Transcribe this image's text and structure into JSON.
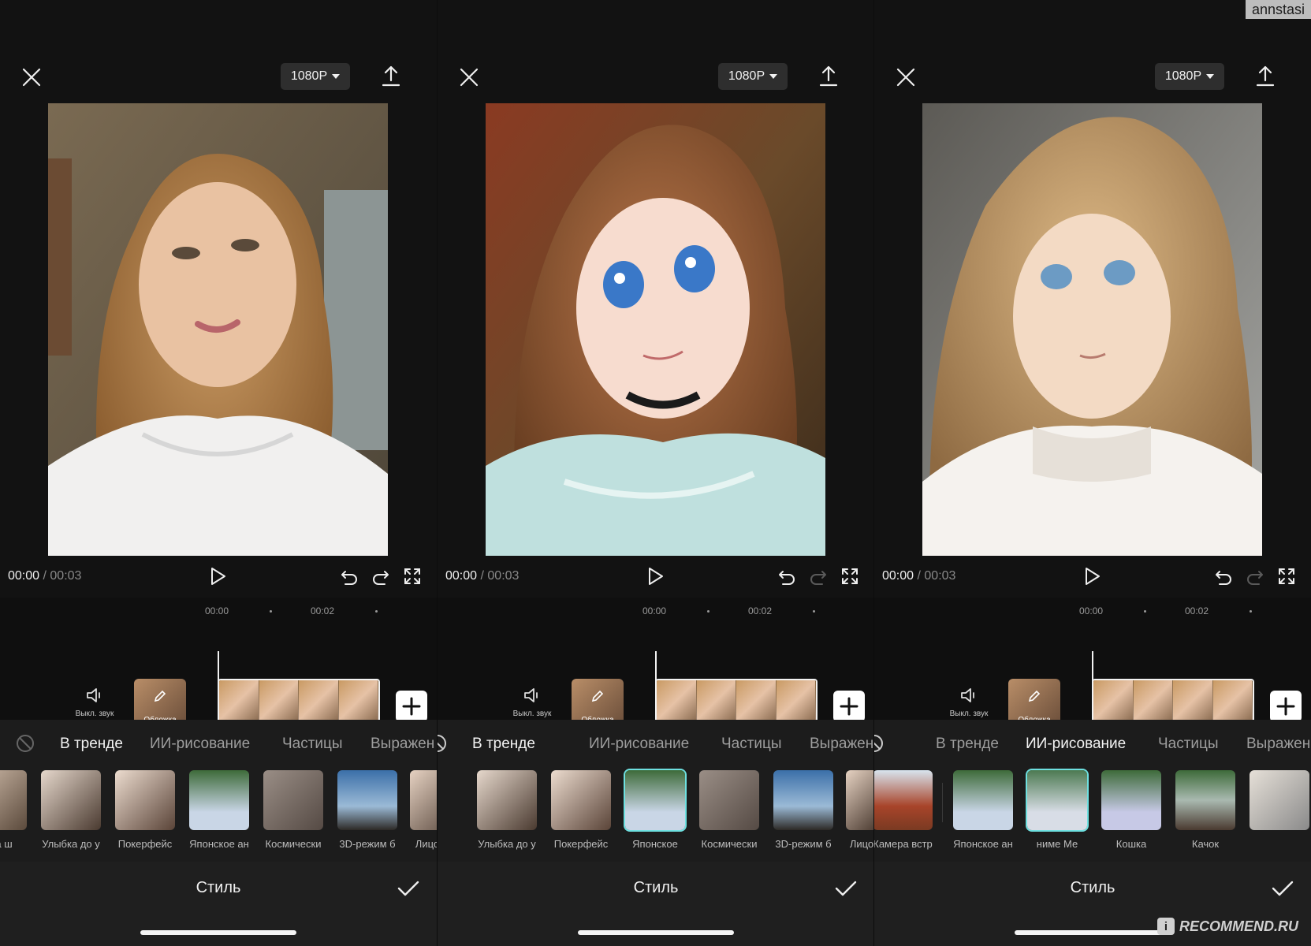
{
  "watermarks": {
    "user": "annstasi",
    "site": "RECOMMEND.RU",
    "site_badge": "i"
  },
  "colors": {
    "background": "#121212",
    "accent_selection": "#6ee0e0"
  },
  "panels": [
    {
      "resolution": "1080P",
      "time_current": "00:00",
      "time_sep": "/",
      "time_total": "00:03",
      "ruler": [
        "00:00",
        "00:02"
      ],
      "mute_label": "Выкл. звук",
      "cover_label": "Обложка",
      "redo_enabled": true,
      "tabs": [
        "В тренде",
        "ИИ-рисование",
        "Частицы",
        "Выражен"
      ],
      "active_tab": 0,
      "effects": [
        "а на ш",
        "Улыбка до у",
        "Покерфейс",
        "Японское ан",
        "Космически",
        "3D-режим б",
        "Лицо на ш"
      ],
      "style_title": "Стиль"
    },
    {
      "resolution": "1080P",
      "time_current": "00:00",
      "time_sep": "/",
      "time_total": "00:03",
      "ruler": [
        "00:00",
        "00:02"
      ],
      "mute_label": "Выкл. звук",
      "cover_label": "Обложка",
      "redo_enabled": false,
      "tabs": [
        "В тренде",
        "ИИ-рисование",
        "Частицы",
        "Выражен"
      ],
      "active_tab": 0,
      "effects": [
        "Улыбка до у",
        "Покерфейс",
        "Японское",
        "Космически",
        "3D-режим б",
        "Лицо"
      ],
      "selected_effect": 2,
      "style_title": "Стиль"
    },
    {
      "resolution": "1080P",
      "time_current": "00:00",
      "time_sep": "/",
      "time_total": "00:03",
      "ruler": [
        "00:00",
        "00:02"
      ],
      "mute_label": "Выкл. звук",
      "cover_label": "Обложка",
      "redo_enabled": false,
      "tabs": [
        "В тренде",
        "ИИ-рисование",
        "Частицы",
        "Выражен"
      ],
      "active_tab": 1,
      "effects": [
        "Камера встр",
        "Японское ан",
        "ниме Ме",
        "Кошка",
        "Качок"
      ],
      "selected_effect": 2,
      "style_title": "Стиль"
    }
  ]
}
